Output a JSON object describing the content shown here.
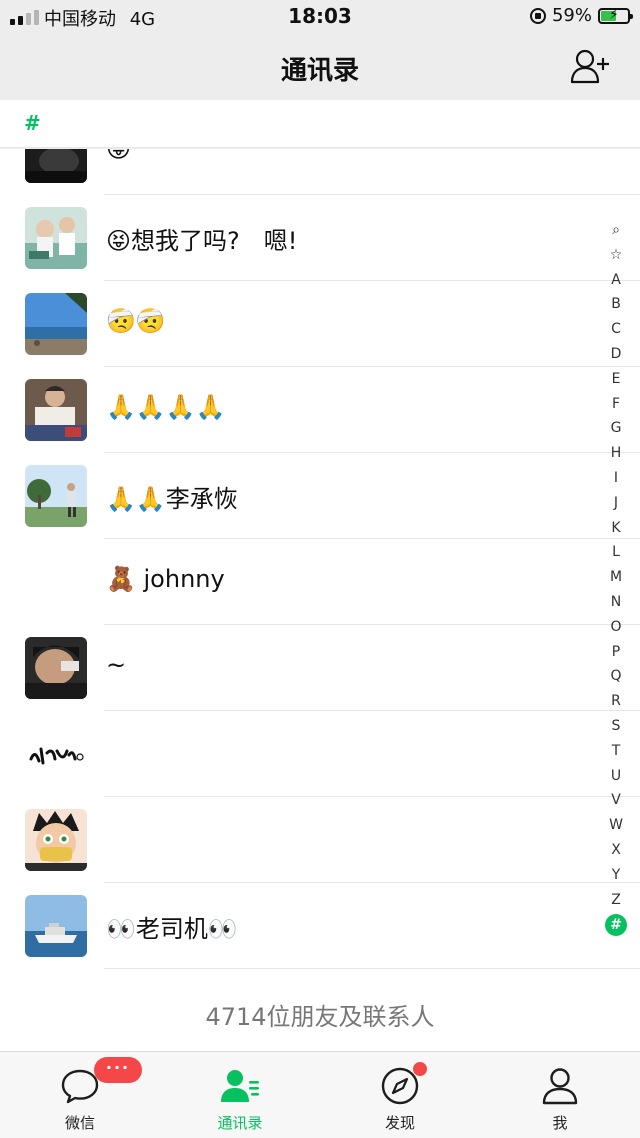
{
  "status_bar": {
    "carrier": "中国移动",
    "network": "4G",
    "time": "18:03",
    "battery": "59%"
  },
  "nav": {
    "title": "通讯录"
  },
  "section": {
    "letter": "#"
  },
  "contacts": [
    {
      "name": "😝",
      "avatar": "avatar-dark-photo"
    },
    {
      "name": "😝想我了吗?　嗯!",
      "avatar": "avatar-people-photo"
    },
    {
      "name": "🤕🤕",
      "avatar": "avatar-beach-photo"
    },
    {
      "name": "🙏🙏🙏🙏",
      "avatar": "avatar-man-photo"
    },
    {
      "name": "🙏🙏李承恢",
      "avatar": "avatar-outdoor-photo"
    },
    {
      "name": "🧸 johnny",
      "avatar": "avatar-blank"
    },
    {
      "name": "~",
      "avatar": "avatar-face-photo"
    },
    {
      "name": "",
      "avatar": "avatar-calligraphy-logo"
    },
    {
      "name": "",
      "avatar": "avatar-cartoon-boy"
    },
    {
      "name": "👀老司机👀",
      "avatar": "avatar-yacht-photo"
    }
  ],
  "index_letters": [
    "⌕",
    "☆",
    "A",
    "B",
    "C",
    "D",
    "E",
    "F",
    "G",
    "H",
    "I",
    "J",
    "K",
    "L",
    "M",
    "N",
    "O",
    "P",
    "Q",
    "R",
    "S",
    "T",
    "U",
    "V",
    "W",
    "X",
    "Y",
    "Z",
    "#"
  ],
  "footer": {
    "count_text": "4714位朋友及联系人"
  },
  "tabs": [
    {
      "label": "微信",
      "icon": "chat-bubble-icon",
      "badge": "···"
    },
    {
      "label": "通讯录",
      "icon": "contacts-icon",
      "active": true
    },
    {
      "label": "发现",
      "icon": "compass-icon",
      "dot": true
    },
    {
      "label": "我",
      "icon": "person-icon"
    }
  ],
  "colors": {
    "accent": "#07c160",
    "badge": "#f44848"
  }
}
